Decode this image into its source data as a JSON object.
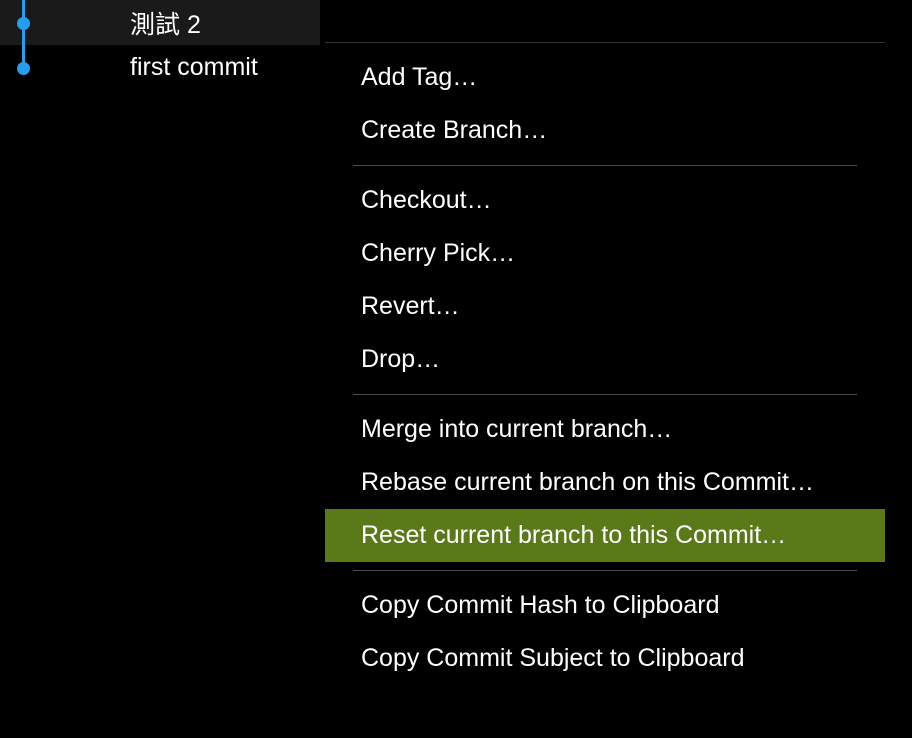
{
  "commits": [
    {
      "message": "測試 2",
      "selected": true
    },
    {
      "message": "first commit",
      "selected": false
    }
  ],
  "menu": {
    "groups": [
      [
        {
          "label": "Add Tag…",
          "highlighted": false
        },
        {
          "label": "Create Branch…",
          "highlighted": false
        }
      ],
      [
        {
          "label": "Checkout…",
          "highlighted": false
        },
        {
          "label": "Cherry Pick…",
          "highlighted": false
        },
        {
          "label": "Revert…",
          "highlighted": false
        },
        {
          "label": "Drop…",
          "highlighted": false
        }
      ],
      [
        {
          "label": "Merge into current branch…",
          "highlighted": false
        },
        {
          "label": "Rebase current branch on this Commit…",
          "highlighted": false
        },
        {
          "label": "Reset current branch to this Commit…",
          "highlighted": true
        }
      ],
      [
        {
          "label": "Copy Commit Hash to Clipboard",
          "highlighted": false
        },
        {
          "label": "Copy Commit Subject to Clipboard",
          "highlighted": false
        }
      ]
    ]
  }
}
